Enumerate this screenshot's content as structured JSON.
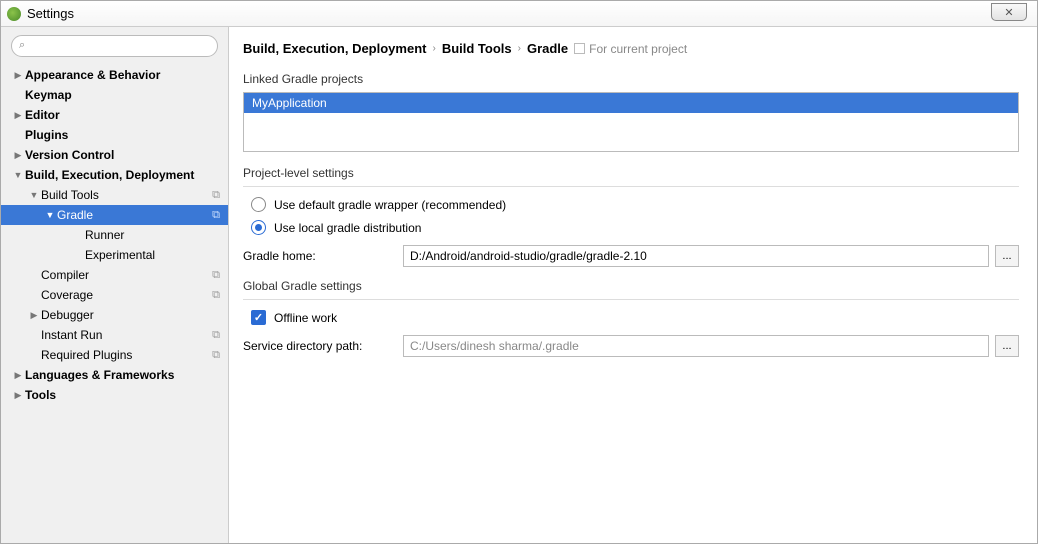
{
  "window": {
    "title": "Settings"
  },
  "search": {
    "placeholder": ""
  },
  "sidebar": {
    "items": [
      {
        "label": "Appearance & Behavior",
        "bold": true,
        "arrow": "▶",
        "indent": 0
      },
      {
        "label": "Keymap",
        "bold": true,
        "indent": 0
      },
      {
        "label": "Editor",
        "bold": true,
        "arrow": "▶",
        "indent": 0
      },
      {
        "label": "Plugins",
        "bold": true,
        "indent": 0
      },
      {
        "label": "Version Control",
        "bold": true,
        "arrow": "▶",
        "indent": 0
      },
      {
        "label": "Build, Execution, Deployment",
        "bold": true,
        "arrow": "▼",
        "indent": 0
      },
      {
        "label": "Build Tools",
        "arrow": "▼",
        "indent": 1,
        "copy": true
      },
      {
        "label": "Gradle",
        "arrow": "▼",
        "indent": 2,
        "selected": true,
        "copy": true
      },
      {
        "label": "Runner",
        "indent": 3
      },
      {
        "label": "Experimental",
        "indent": 3
      },
      {
        "label": "Compiler",
        "indent": 1,
        "copy": true
      },
      {
        "label": "Coverage",
        "indent": 1,
        "copy": true
      },
      {
        "label": "Debugger",
        "arrow": "▶",
        "indent": 1
      },
      {
        "label": "Instant Run",
        "indent": 1,
        "copy": true
      },
      {
        "label": "Required Plugins",
        "indent": 1,
        "copy": true
      },
      {
        "label": "Languages & Frameworks",
        "bold": true,
        "arrow": "▶",
        "indent": 0
      },
      {
        "label": "Tools",
        "bold": true,
        "arrow": "▶",
        "indent": 0
      }
    ]
  },
  "breadcrumb": {
    "a": "Build, Execution, Deployment",
    "b": "Build Tools",
    "c": "Gradle",
    "scope": "For current project"
  },
  "sections": {
    "linked": "Linked Gradle projects",
    "project_level": "Project-level settings",
    "global": "Global Gradle settings"
  },
  "linked_project": "MyApplication",
  "radios": {
    "default_wrapper": "Use default gradle wrapper (recommended)",
    "local_dist": "Use local gradle distribution"
  },
  "fields": {
    "gradle_home_label": "Gradle home:",
    "gradle_home_value": "D:/Android/android-studio/gradle/gradle-2.10",
    "offline_work": "Offline work",
    "service_dir_label": "Service directory path:",
    "service_dir_value": "C:/Users/dinesh sharma/.gradle"
  },
  "browse": "..."
}
